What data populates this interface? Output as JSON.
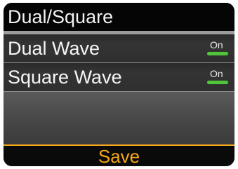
{
  "header": {
    "title": "Dual/Square"
  },
  "menu": {
    "items": [
      {
        "label": "Dual Wave",
        "state": "On",
        "toggle_color": "#52c43a"
      },
      {
        "label": "Square Wave",
        "state": "On",
        "toggle_color": "#52c43a"
      }
    ]
  },
  "footer": {
    "action_label": "Save",
    "accent_color": "#f4a716"
  }
}
